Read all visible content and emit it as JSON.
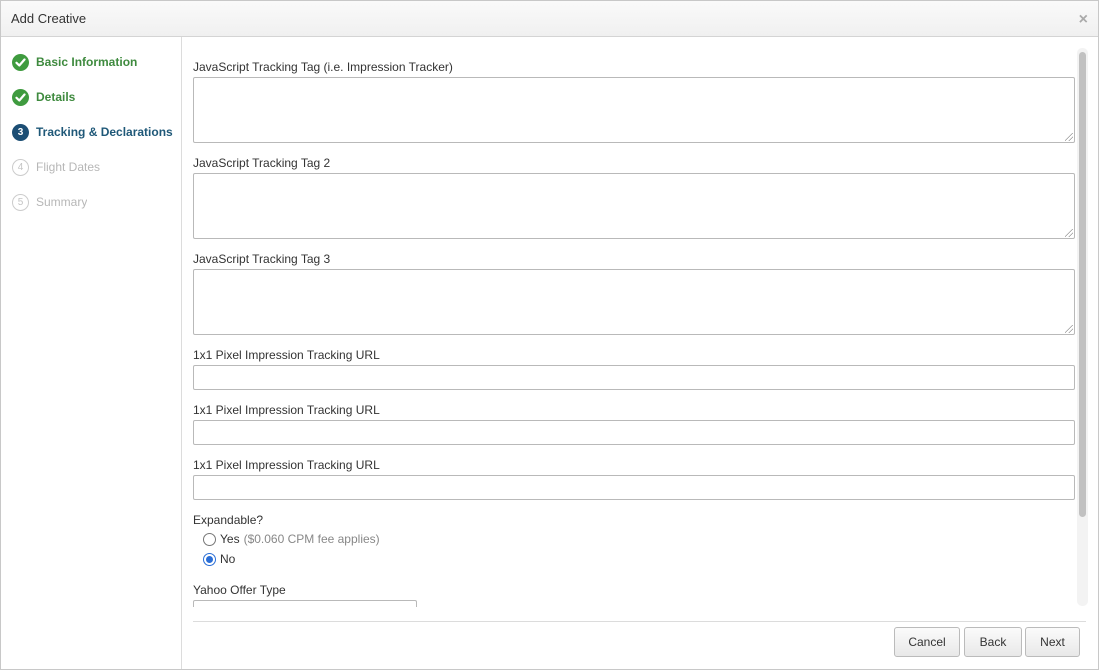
{
  "dialog": {
    "title": "Add Creative",
    "close_glyph": "×"
  },
  "steps": [
    {
      "number": "1",
      "label": "Basic Information",
      "state": "done",
      "icon": "check-icon"
    },
    {
      "number": "2",
      "label": "Details",
      "state": "done",
      "icon": "check-icon"
    },
    {
      "number": "3",
      "label": "Tracking & Declarations",
      "state": "current",
      "icon": "step-number-icon"
    },
    {
      "number": "4",
      "label": "Flight Dates",
      "state": "pending",
      "icon": "step-number-icon"
    },
    {
      "number": "5",
      "label": "Summary",
      "state": "pending",
      "icon": "step-number-icon"
    }
  ],
  "form": {
    "js_tag_1": {
      "label": "JavaScript Tracking Tag (i.e. Impression Tracker)",
      "value": ""
    },
    "js_tag_2": {
      "label": "JavaScript Tracking Tag 2",
      "value": ""
    },
    "js_tag_3": {
      "label": "JavaScript Tracking Tag 3",
      "value": ""
    },
    "pixel_url_1": {
      "label": "1x1 Pixel Impression Tracking URL",
      "value": ""
    },
    "pixel_url_2": {
      "label": "1x1 Pixel Impression Tracking URL",
      "value": ""
    },
    "pixel_url_3": {
      "label": "1x1 Pixel Impression Tracking URL",
      "value": ""
    },
    "expandable": {
      "label": "Expandable?",
      "options": [
        {
          "label": "Yes",
          "note": "($0.060 CPM fee applies)",
          "checked": false
        },
        {
          "label": "No",
          "note": "",
          "checked": true
        }
      ]
    },
    "offer_type": {
      "label": "Yahoo Offer Type"
    }
  },
  "buttons": {
    "cancel": "Cancel",
    "back": "Back",
    "next": "Next"
  },
  "colors": {
    "done": "#3f9b3f",
    "current": "#1c4e74",
    "radio_selected": "#2a6ed6"
  }
}
